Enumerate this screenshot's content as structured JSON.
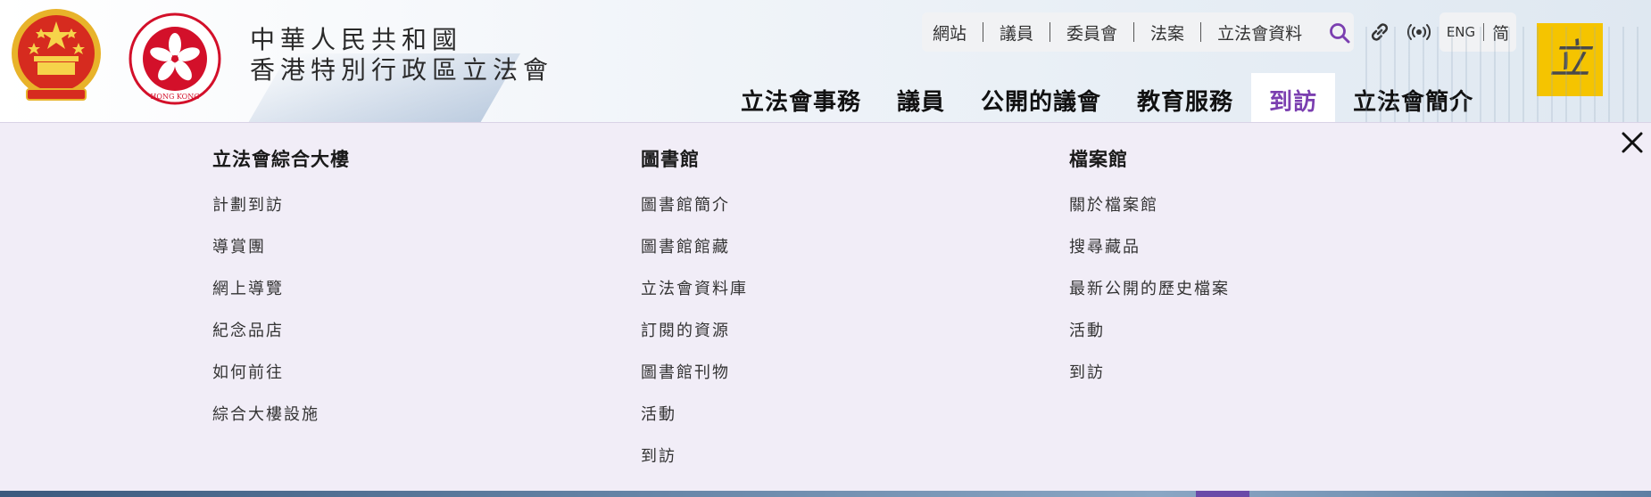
{
  "header": {
    "title_line1": "中華人民共和國",
    "title_line2": "香港特別行政區立法會",
    "hk_emblem_text": "HONG KONG",
    "logo_char": "立",
    "utility_links": [
      "網站",
      "議員",
      "委員會",
      "法案",
      "立法會資料"
    ],
    "language": {
      "eng": "ENG",
      "simplified": "简"
    },
    "nav": [
      {
        "label": "立法會事務",
        "active": false
      },
      {
        "label": "議員",
        "active": false
      },
      {
        "label": "公開的議會",
        "active": false
      },
      {
        "label": "教育服務",
        "active": false
      },
      {
        "label": "到訪",
        "active": true
      },
      {
        "label": "立法會簡介",
        "active": false
      }
    ]
  },
  "mega_menu": {
    "columns": [
      {
        "heading": "立法會綜合大樓",
        "items": [
          "計劃到訪",
          "導賞團",
          "網上導覽",
          "紀念品店",
          "如何前往",
          "綜合大樓設施"
        ]
      },
      {
        "heading": "圖書館",
        "items": [
          "圖書館簡介",
          "圖書館館藏",
          "立法會資料庫",
          "訂閱的資源",
          "圖書館刊物",
          "活動",
          "到訪"
        ]
      },
      {
        "heading": "檔案館",
        "items": [
          "關於檔案館",
          "搜尋藏品",
          "最新公開的歷史檔案",
          "活動",
          "到訪"
        ]
      }
    ]
  },
  "colors": {
    "accent_purple": "#7b3fb0",
    "menu_background": "#f1edf7",
    "logo_yellow": "#f5c400",
    "hk_red": "#d3102a",
    "prc_red": "#d62b1f",
    "prc_gold": "#e8b32a"
  },
  "icons": {
    "search": "search-icon",
    "link": "link-icon",
    "broadcast": "broadcast-icon",
    "close": "close-icon"
  }
}
